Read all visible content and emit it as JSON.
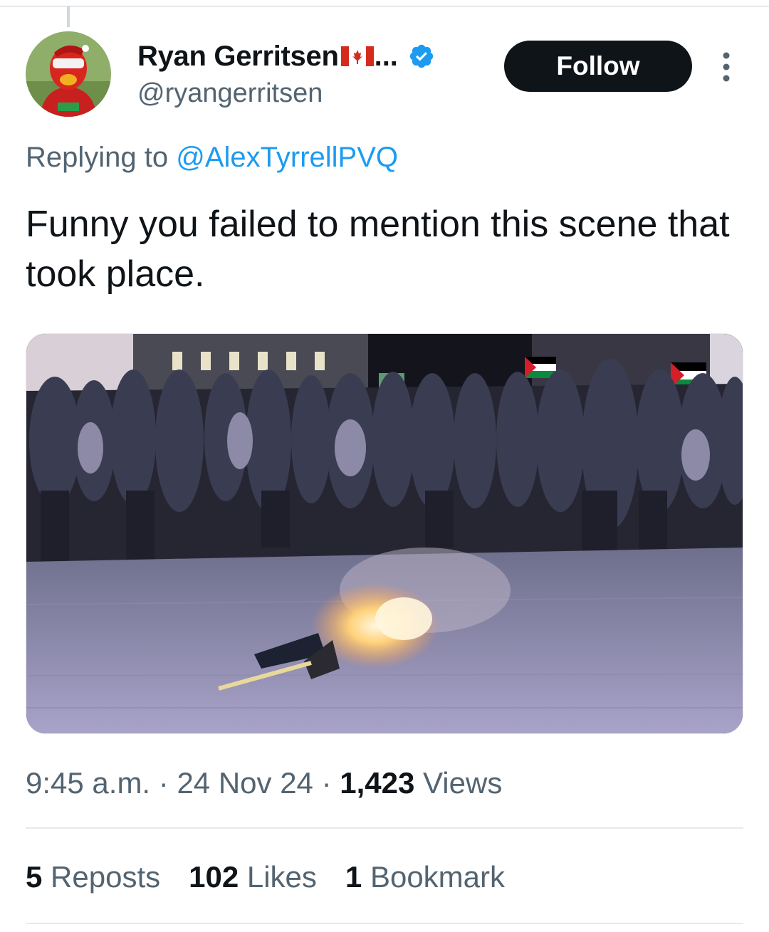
{
  "author": {
    "display_name": "Ryan Gerritsen",
    "flag_icon": "canada-flag-icon",
    "truncation": "...",
    "verified_icon": "verified-badge-icon",
    "handle": "@ryangerritsen"
  },
  "follow_label": "Follow",
  "more_icon": "more-options-icon",
  "reply": {
    "prefix": "Replying to",
    "mention": "@AlexTyrrellPVQ"
  },
  "text": "Funny you failed to mention this scene that took place.",
  "meta": {
    "time": "9:45 a.m.",
    "sep1": "·",
    "date": "24 Nov 24",
    "sep2": "·",
    "views_count": "1,423",
    "views_label": "Views"
  },
  "stats": {
    "reposts_count": "5",
    "reposts_label": "Reposts",
    "likes_count": "102",
    "likes_label": "Likes",
    "bookmarks_count": "1",
    "bookmarks_label": "Bookmark"
  },
  "colors": {
    "link": "#1d9bf0",
    "secondary_text": "#536471",
    "primary_text": "#0f1419",
    "verified": "#1d9bf0"
  }
}
